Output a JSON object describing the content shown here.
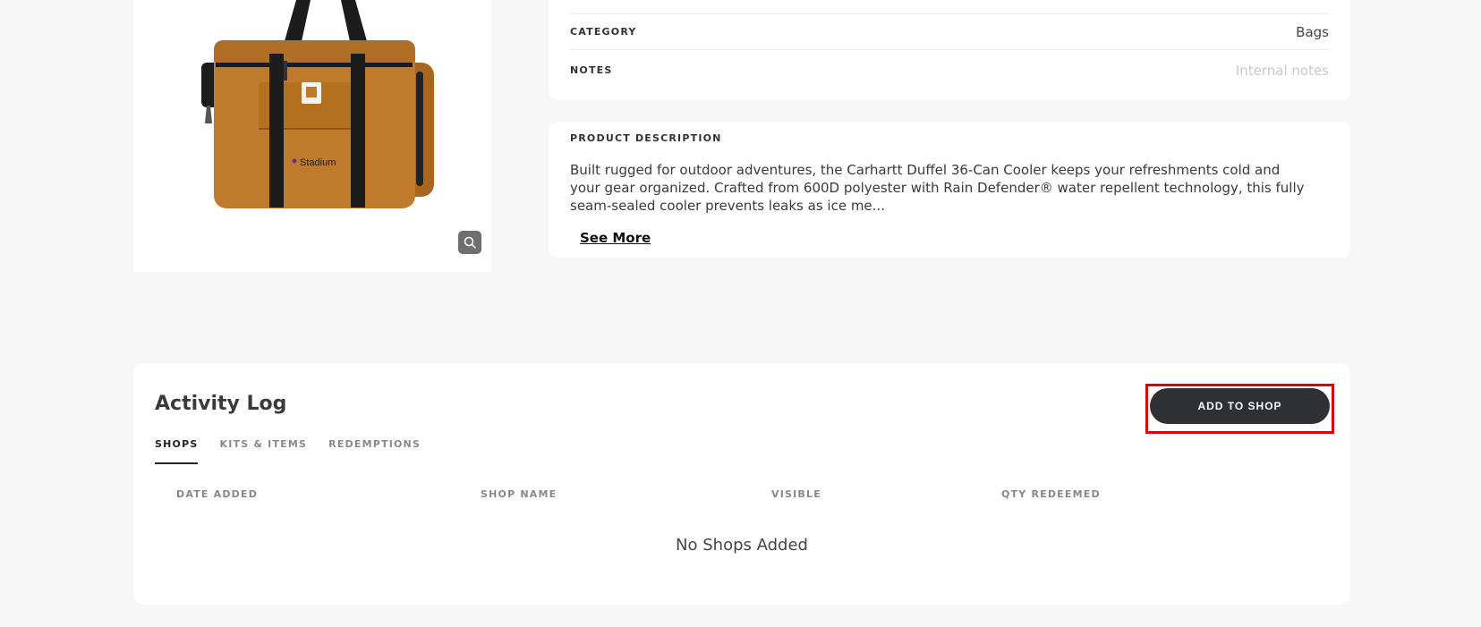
{
  "product": {
    "logo_text": "Stadium"
  },
  "info": {
    "category_label": "CATEGORY",
    "category_value": "Bags",
    "notes_label": "NOTES",
    "notes_placeholder": "Internal notes"
  },
  "description": {
    "label": "PRODUCT DESCRIPTION",
    "text": "Built rugged for outdoor adventures, the Carhartt Duffel 36-Can Cooler keeps your refreshments cold and your gear organized. Crafted from 600D polyester with Rain Defender® water repellent technology, this fully seam-sealed cooler prevents leaks as ice me...",
    "see_more": "See More"
  },
  "activity": {
    "title": "Activity Log",
    "add_button": "ADD TO SHOP",
    "tabs": [
      {
        "label": "SHOPS",
        "active": true
      },
      {
        "label": "KITS & ITEMS",
        "active": false
      },
      {
        "label": "REDEMPTIONS",
        "active": false
      }
    ],
    "columns": [
      "DATE ADDED",
      "SHOP NAME",
      "VISIBLE",
      "QTY REDEEMED"
    ],
    "empty_message": "No Shops Added"
  },
  "icons": {
    "zoom": "search-icon",
    "arrow": "arrow-right-icon"
  },
  "colors": {
    "background": "#f7f7f7",
    "button": "#2e3033",
    "highlight": "#e00000",
    "bag": "#c07a2c"
  }
}
